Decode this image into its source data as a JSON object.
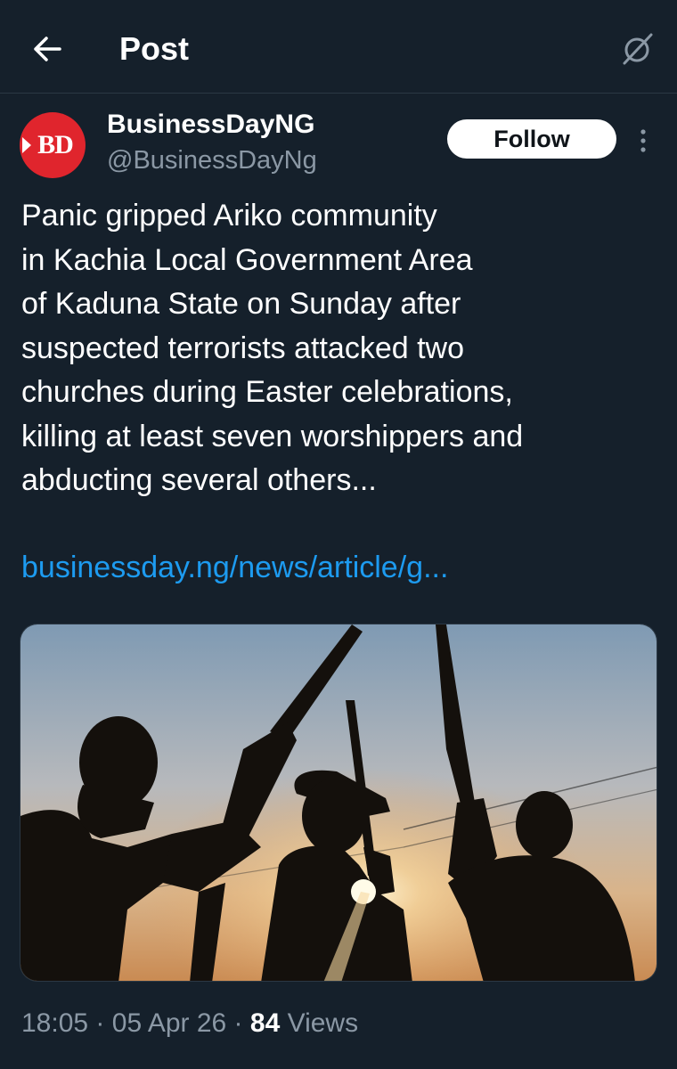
{
  "header": {
    "title": "Post",
    "back_icon": "arrow-left-icon",
    "grok_icon": "grok-icon"
  },
  "author": {
    "avatar_text": "BD",
    "display_name": "BusinessDayNG",
    "handle": "@BusinessDayNg",
    "follow_label": "Follow",
    "more_icon": "more-vertical-icon",
    "avatar_color": "#e0252d"
  },
  "post": {
    "text": "Panic gripped Ariko community\nin Kachia Local Government Area\nof Kaduna State on Sunday after\nsuspected terrorists attacked two\nchurches during Easter celebrations,\nkilling at least seven worshippers and\nabducting several others...",
    "link": "businessday.ng/news/article/g..."
  },
  "meta": {
    "time": "18:05",
    "separator": "·",
    "date": "05 Apr 26",
    "views_count": "84",
    "views_label": "Views"
  },
  "colors": {
    "background": "#15202b",
    "link": "#1d9bf0",
    "secondary_text": "#8b98a5"
  }
}
